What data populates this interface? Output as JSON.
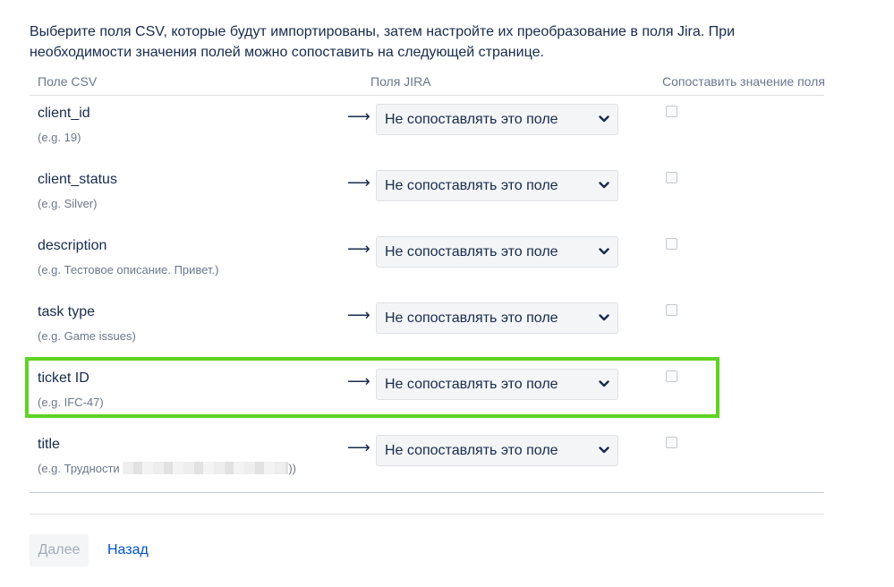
{
  "intro_text": "Выберите поля CSV, которые будут импортированы, затем настройте их преобразование в поля Jira. При необходимости значения полей можно сопоставить на следующей странице.",
  "headers": {
    "csv_field": "Поле CSV",
    "jira_fields": "Поля JIRA",
    "map_value": "Сопоставить значение поля"
  },
  "arrow": "⟶",
  "rows": [
    {
      "name": "client_id",
      "example": "(e.g. 19)",
      "select_value": "Не сопоставлять это поле",
      "mapped": false
    },
    {
      "name": "client_status",
      "example": "(e.g. Silver)",
      "select_value": "Не сопоставлять это поле",
      "mapped": false
    },
    {
      "name": "description",
      "example": "(e.g. Тестовое описание. Привет.)",
      "select_value": "Не сопоставлять это поле",
      "mapped": false
    },
    {
      "name": "task type",
      "example": "(e.g. Game issues)",
      "select_value": "Не сопоставлять это поле",
      "mapped": false
    },
    {
      "name": "ticket ID",
      "example": "(e.g. IFC-47)",
      "select_value": "Не сопоставлять это поле",
      "mapped": false,
      "highlighted": true
    },
    {
      "name": "title",
      "example_prefix": "(e.g. Трудности",
      "example_suffix": "))",
      "select_value": "Не сопоставлять это поле",
      "mapped": false
    }
  ],
  "buttons": {
    "next_label": "Далее",
    "back_label": "Назад"
  },
  "colors": {
    "highlight": "#5fd323",
    "link": "#0052cc"
  }
}
